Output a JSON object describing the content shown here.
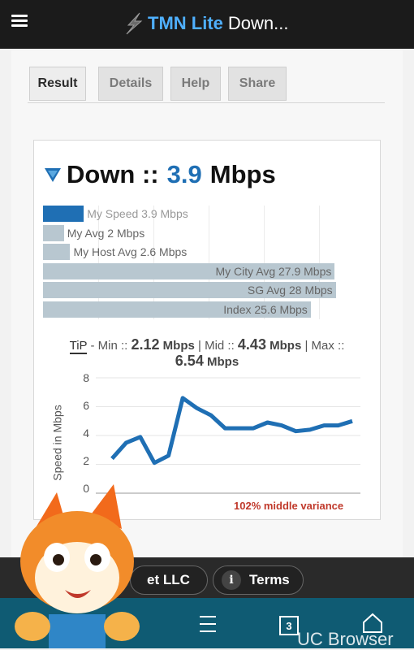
{
  "header": {
    "brand": "TMN Lite",
    "rest": "Down..."
  },
  "tabs": [
    "Result",
    "Details",
    "Help",
    "Share"
  ],
  "result": {
    "label": "Down ::",
    "value": "3.9",
    "unit": "Mbps"
  },
  "bars": [
    {
      "label": "My Speed 3.9 Mbps",
      "value": 3.9,
      "highlight": true
    },
    {
      "label": "My Avg 2 Mbps",
      "value": 2
    },
    {
      "label": "My Host Avg 2.6 Mbps",
      "value": 2.6
    },
    {
      "label": "My City Avg 27.9 Mbps",
      "value": 27.9
    },
    {
      "label": "SG Avg 28 Mbps",
      "value": 28
    },
    {
      "label": "Index 25.6 Mbps",
      "value": 25.6
    }
  ],
  "tip": {
    "key": "TiP",
    "min_label": " - Min :: ",
    "min": "2.12",
    "mid_label": " | Mid :: ",
    "mid": "4.43",
    "max_label": " | Max :: ",
    "max": "6.54",
    "unit": "Mbps"
  },
  "chart_data": {
    "type": "line",
    "ylabel": "Speed in Mbps",
    "ylim": [
      0,
      8
    ],
    "yticks": [
      "8",
      "6",
      "4",
      "2",
      "0"
    ],
    "x": [
      1,
      2,
      3,
      4,
      5,
      6,
      7,
      8,
      9,
      10,
      11,
      12,
      13,
      14,
      15,
      16,
      17,
      18
    ],
    "values": [
      2.4,
      3.5,
      3.9,
      2.1,
      2.6,
      6.6,
      5.9,
      5.4,
      4.5,
      4.5,
      4.5,
      4.9,
      4.7,
      4.3,
      4.4,
      4.7,
      4.7,
      5.0
    ],
    "annotation": "102% middle variance",
    "color": "#1f6fb4"
  },
  "footer": {
    "left_label": "et LLC",
    "right_label": "Terms",
    "info_glyph": "i"
  },
  "browser": {
    "tabs_count": "3",
    "brand": "UC Browser"
  },
  "colors": {
    "header_bg": "#1b1b1b",
    "accent": "#1f6fb4",
    "bar": "#b8c7d0"
  }
}
